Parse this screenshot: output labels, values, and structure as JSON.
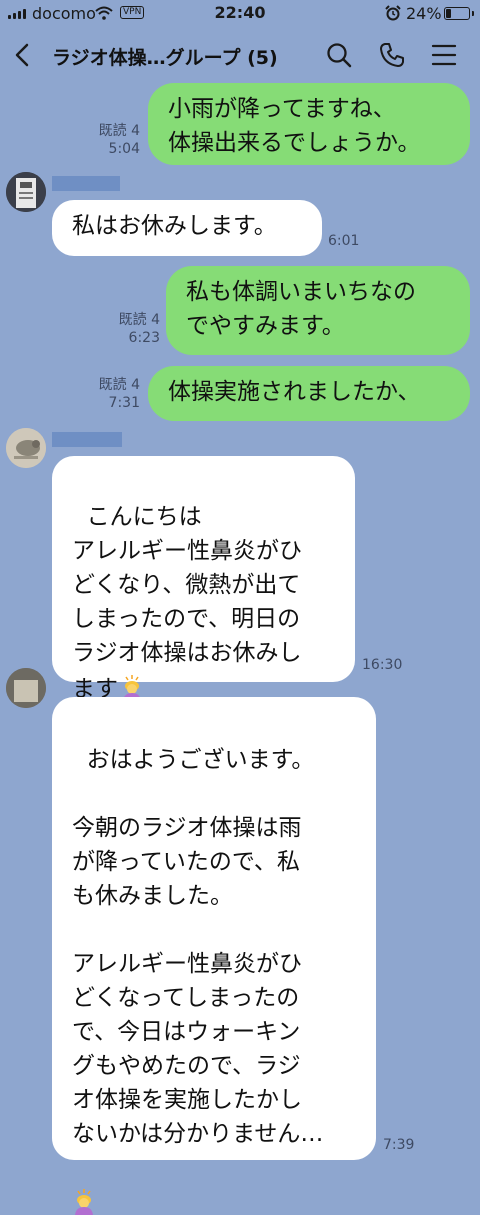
{
  "status_bar": {
    "carrier": "docomo",
    "vpn": "VPN",
    "time": "22:40",
    "battery_percent": "24%",
    "battery_level": 0.24
  },
  "header": {
    "title": "ラジオ体操…グループ (5)",
    "icons": [
      "back-icon",
      "search-icon",
      "phone-icon",
      "menu-icon"
    ]
  },
  "messages": [
    {
      "type": "sent",
      "lines": "小雨が降ってますね、\n体操出来るでしょうか。",
      "read": "既読 4",
      "time": "5:04"
    },
    {
      "type": "received",
      "lines": "私はお休みします。",
      "time": "6:01"
    },
    {
      "type": "sent",
      "lines": "私も体調いまいちなの\nでやすみます。",
      "read": "既読 4",
      "time": "6:23"
    },
    {
      "type": "sent",
      "lines": "体操実施されましたか、",
      "read": "既読 4",
      "time": "7:31"
    },
    {
      "type": "received",
      "lines": "こんにちは\nアレルギー性鼻炎がひ\nどくなり、微熱が出て\nしまったので、明日の\nラジオ体操はお休みし\nます",
      "emoji": "person-bowing-emoji",
      "time": "16:30"
    },
    {
      "type": "received",
      "lines": "おはようございます。\n\n今朝のラジオ体操は雨\nが降っていたので、私\nも休みました。\n\nアレルギー性鼻炎がひ\nどくなってしまったの\nで、今日はウォーキン\nグもやめたので、ラジ\nオ体操を実施したかし\nないかは分かりません…",
      "emoji": "person-bowing-emoji",
      "time": "7:39"
    }
  ],
  "colors": {
    "background": "#8ea6cf",
    "sent_bubble": "#86dc76",
    "received_bubble": "#ffffff"
  }
}
